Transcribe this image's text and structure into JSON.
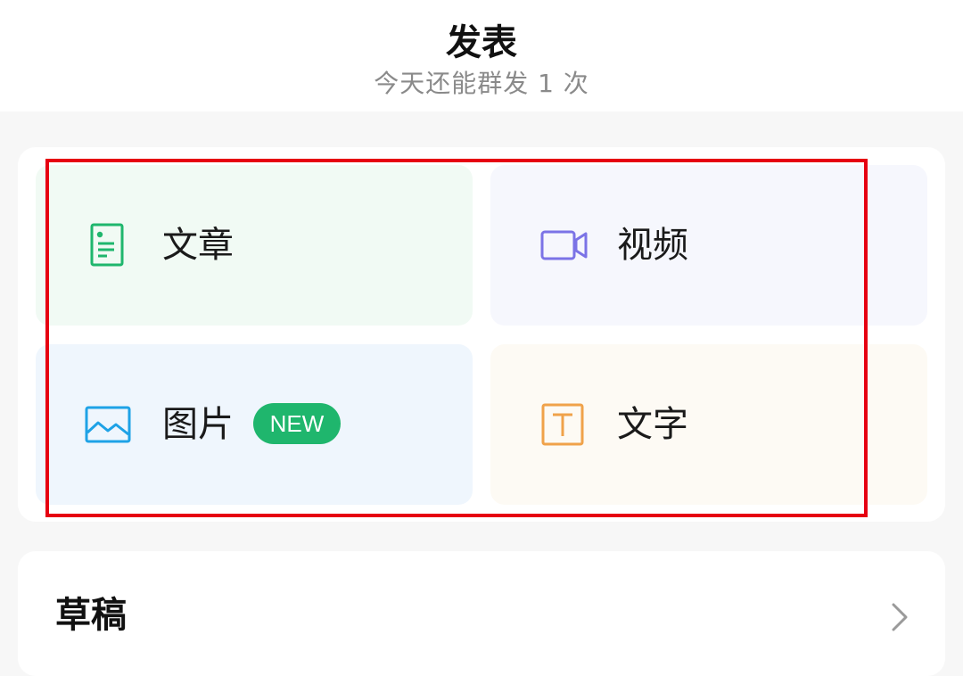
{
  "header": {
    "title": "发表",
    "subtitle": "今天还能群发 1 次"
  },
  "publish_options": [
    {
      "label": "文章",
      "icon": "article-icon",
      "accent": "#1fb66d"
    },
    {
      "label": "视频",
      "icon": "video-camera-icon",
      "accent": "#7b73e6"
    },
    {
      "label": "图片",
      "icon": "image-icon",
      "accent": "#1ea2e6",
      "badge": "NEW"
    },
    {
      "label": "文字",
      "icon": "text-t-icon",
      "accent": "#f0a24a"
    }
  ],
  "drafts": {
    "label": "草稿"
  },
  "colors": {
    "highlight_border": "#e60012",
    "badge_bg": "#1fb66d"
  }
}
